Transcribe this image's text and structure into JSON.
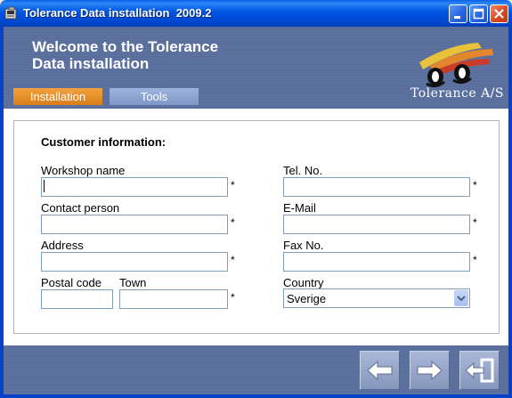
{
  "window": {
    "title": "Tolerance Data installation  2009.2",
    "controls": [
      "minimize",
      "maximize",
      "close"
    ]
  },
  "header": {
    "welcome_line1": "Welcome to the Tolerance",
    "welcome_line2": "Data installation",
    "tabs": [
      {
        "label": "Installation",
        "active": true
      },
      {
        "label": "Tools",
        "active": false
      }
    ],
    "logo_text": "Tolerance A/S"
  },
  "form": {
    "section_title": "Customer information:",
    "required_marker": "*",
    "fields": {
      "workshop_name": {
        "label": "Workshop name",
        "value": "",
        "required": true
      },
      "contact_person": {
        "label": "Contact person",
        "value": "",
        "required": true
      },
      "address": {
        "label": "Address",
        "value": "",
        "required": true
      },
      "postal_code": {
        "label": "Postal code",
        "value": ""
      },
      "town": {
        "label": "Town",
        "value": "",
        "required": true
      },
      "tel_no": {
        "label": "Tel. No.",
        "value": "",
        "required": true
      },
      "email": {
        "label": "E-Mail",
        "value": "",
        "required": true
      },
      "fax_no": {
        "label": "Fax No.",
        "value": "",
        "required": true
      },
      "country": {
        "label": "Country",
        "value": "Sverige"
      }
    }
  },
  "footer": {
    "buttons": [
      {
        "icon": "arrow-left-icon"
      },
      {
        "icon": "arrow-right-icon"
      },
      {
        "icon": "exit-door-icon"
      }
    ]
  },
  "colors": {
    "titlebar": "#0054e3",
    "banner": "#5a6e9c",
    "tab_active": "#e8912c",
    "tab_inactive": "#8fa5d4"
  }
}
